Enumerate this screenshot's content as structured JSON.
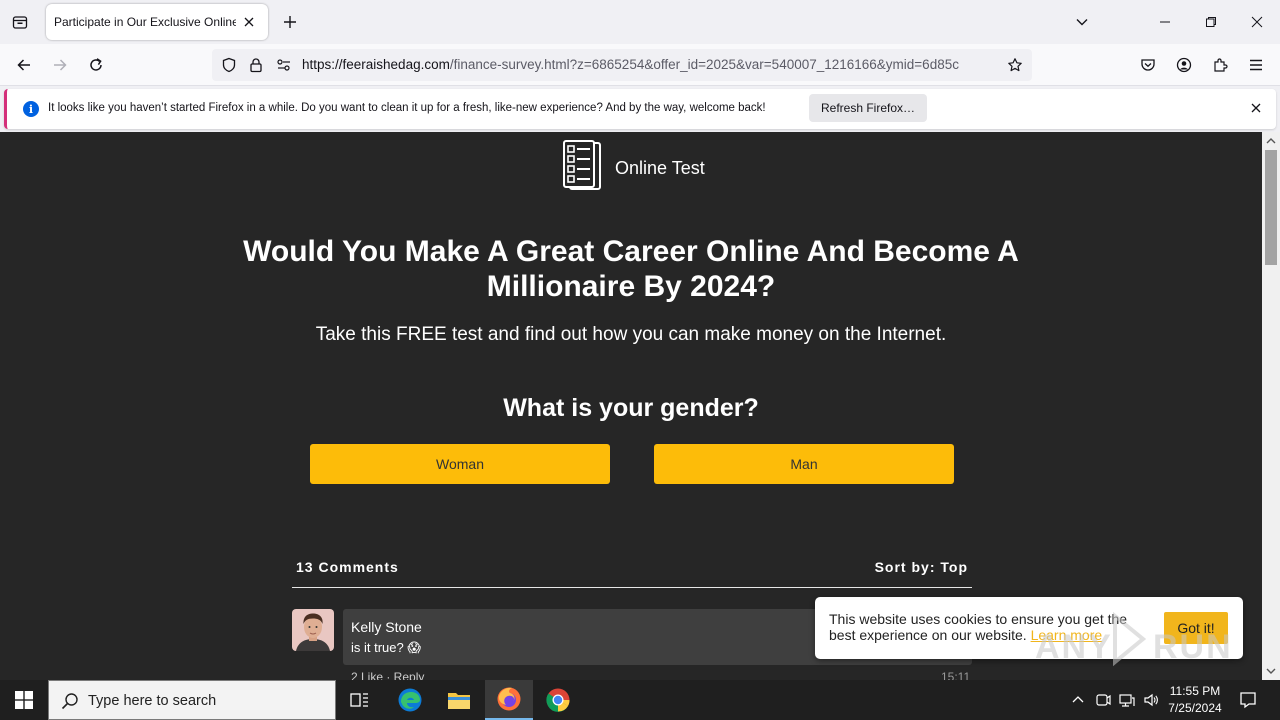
{
  "browser": {
    "tab_title": "Participate in Our Exclusive Online S",
    "url_host": "https://feeraishedag.com",
    "url_path": "/finance-survey.html?z=6865254&offer_id=2025&var=540007_1216166&ymid=6d85c"
  },
  "notification": {
    "message": "It looks like you haven’t started Firefox in a while. Do you want to clean it up for a fresh, like-new experience? And by the way, welcome back!",
    "button_label": "Refresh Firefox…"
  },
  "page": {
    "logo_text": "Online Test",
    "headline": "Would You Make A Great Career Online And Become A Millionaire By 2024?",
    "subheadline": "Take this FREE test and find out how you can make money on the Internet.",
    "question": "What is your gender?",
    "answers": [
      "Woman",
      "Man"
    ],
    "comments_count": "13 Comments",
    "sort_by": "Sort by: Top",
    "comment": {
      "name": "Kelly Stone",
      "text": "is it true? 😱",
      "actions": "2 Like · Reply",
      "time": "15:11"
    },
    "cookie": {
      "text": "This website uses cookies to ensure you get the best experience on our website.",
      "link": "Learn more",
      "button": "Got it!"
    },
    "watermark": "ANY RUN"
  },
  "taskbar": {
    "search_placeholder": "Type here to search",
    "time": "11:55 PM",
    "date": "7/25/2024"
  },
  "colors": {
    "page_background": "#262626",
    "answer_button": "#fdbc09",
    "cookie_accent": "#f1b51c",
    "taskbar": "#1f1f1f"
  }
}
